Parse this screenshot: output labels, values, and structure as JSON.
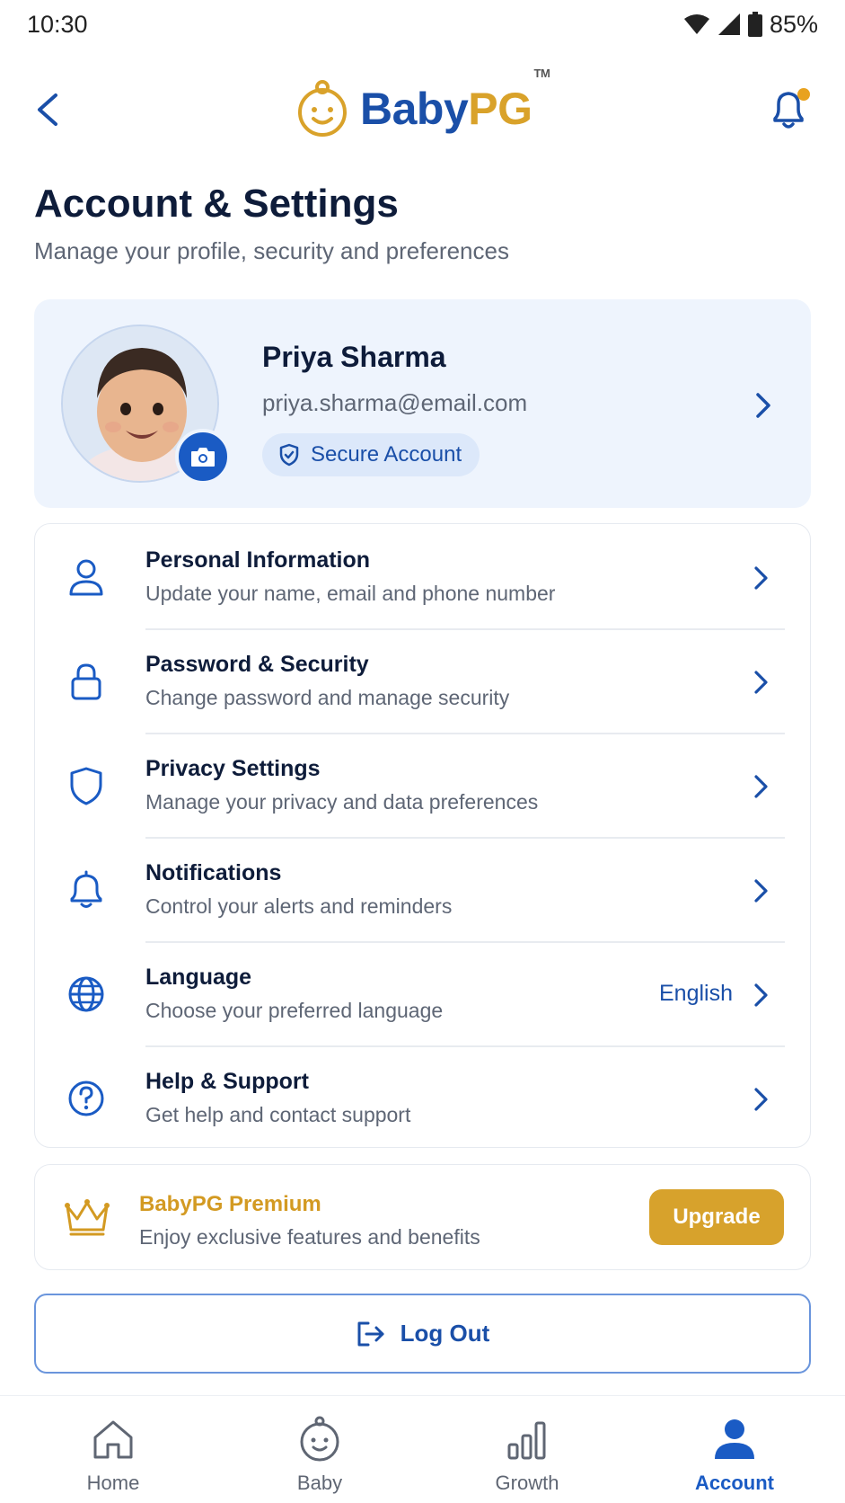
{
  "status_bar": {
    "time": "10:30",
    "battery": "85%",
    "icons": [
      "wifi-icon",
      "cellular-signal-icon",
      "battery-icon"
    ]
  },
  "header": {
    "logo_text_a": "Baby",
    "logo_text_b": "PG",
    "logo_tm": "TM",
    "icons": [
      "back-chevron-icon",
      "baby-face-logo-icon",
      "bell-icon"
    ],
    "notification_dot_color": "#e8a21f"
  },
  "page": {
    "title": "Account & Settings",
    "subtitle": "Manage your profile, security and preferences"
  },
  "profile": {
    "name": "Priya Sharma",
    "email": "priya.sharma@email.com",
    "badge": "Secure Account",
    "icons": [
      "avatar-photo",
      "camera-icon",
      "shield-check-icon",
      "chevron-right-icon"
    ]
  },
  "menu": {
    "items": [
      {
        "title": "Personal Information",
        "desc": "Update your name, email and phone number",
        "icon": "user-icon"
      },
      {
        "title": "Password & Security",
        "desc": "Change password and manage security",
        "icon": "lock-icon"
      },
      {
        "title": "Privacy Settings",
        "desc": "Manage your privacy and data preferences",
        "icon": "shield-icon"
      },
      {
        "title": "Notifications",
        "desc": "Control your alerts and reminders",
        "icon": "bell-icon"
      },
      {
        "title": "Language",
        "desc": "Choose your preferred language",
        "icon": "globe-icon",
        "value": "English"
      },
      {
        "title": "Help & Support",
        "desc": "Get help and contact support",
        "icon": "help-circle-icon"
      }
    ]
  },
  "premium": {
    "title": "BabyPG Premium",
    "desc": "Enjoy exclusive features and benefits",
    "button": "Upgrade",
    "icon": "crown-icon"
  },
  "logout": {
    "label": "Log Out",
    "icon": "logout-icon"
  },
  "bottom_nav": {
    "items": [
      {
        "label": "Home",
        "icon": "home-icon"
      },
      {
        "label": "Baby",
        "icon": "baby-face-icon"
      },
      {
        "label": "Growth",
        "icon": "bar-chart-icon"
      },
      {
        "label": "Account",
        "icon": "account-person-icon",
        "active": true
      }
    ]
  },
  "colors": {
    "primary": "#1a5bc4",
    "primary_dark": "#1a4fa8",
    "accent_gold": "#d7a22c",
    "text_dark": "#0e1c3a",
    "text_muted": "#5e6675",
    "card_tint": "#eef4fd"
  }
}
